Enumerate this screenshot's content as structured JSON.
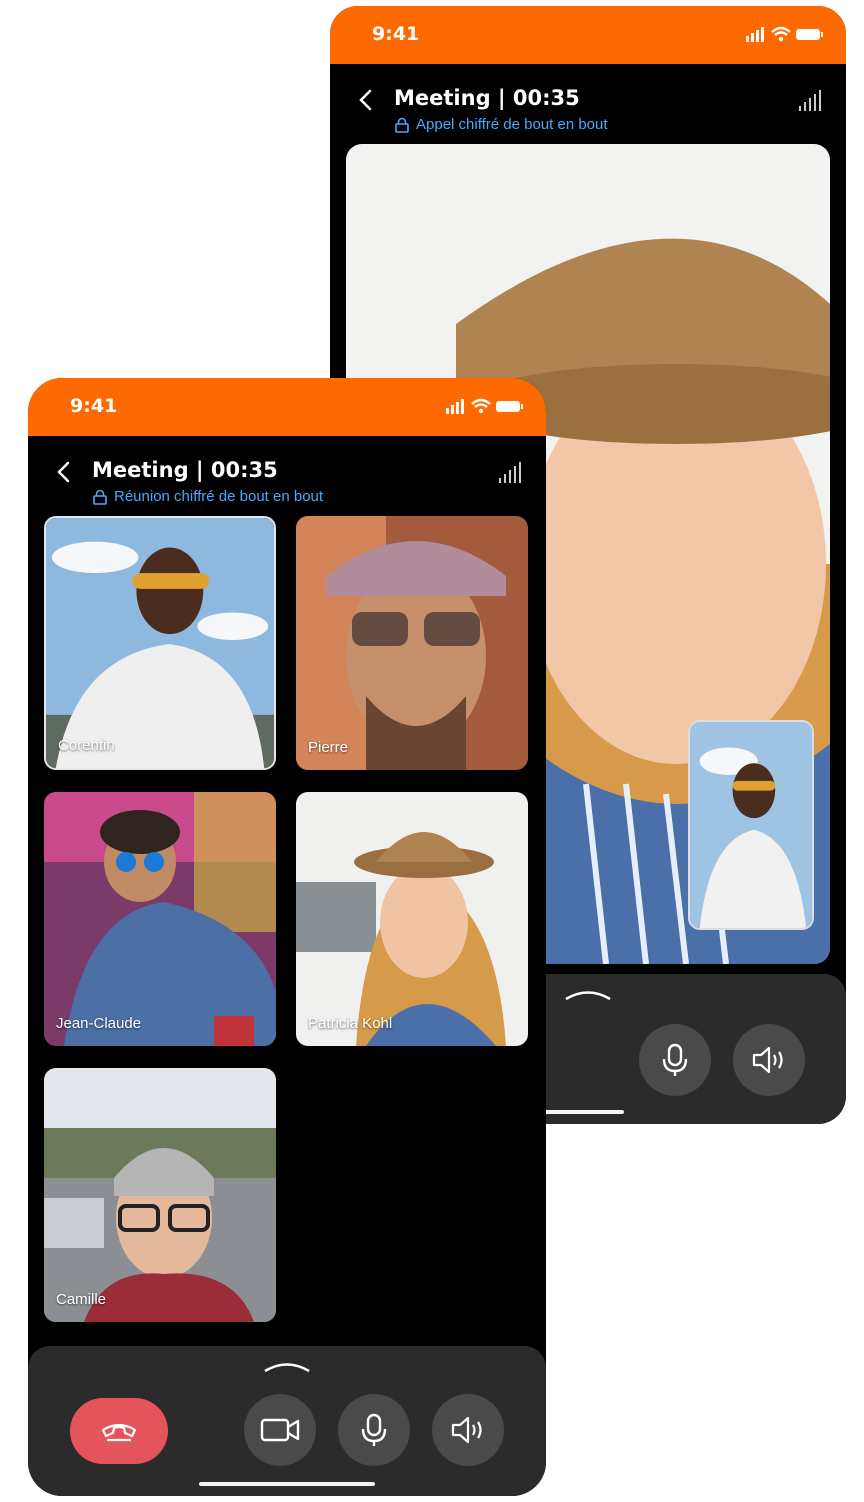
{
  "back_phone": {
    "status_time": "9:41",
    "title": "Meeting | 00:35",
    "encryption_text": "Appel chiffré de bout en bout"
  },
  "front_phone": {
    "status_time": "9:41",
    "title": "Meeting | 00:35",
    "encryption_text": "Réunion chiffré de bout en bout",
    "participants": [
      {
        "name": "Corentin"
      },
      {
        "name": "Pierre"
      },
      {
        "name": "Jean-Claude"
      },
      {
        "name": "Patricia Kohl"
      },
      {
        "name": "Camille"
      }
    ]
  },
  "controls": {
    "icons": [
      "chevron-up-icon",
      "hang-up-icon",
      "video-camera-icon",
      "microphone-icon",
      "speaker-icon"
    ]
  },
  "colors": {
    "brand_orange": "#ff6a00",
    "encryption_blue": "#4aa8ff",
    "hangup_red": "#e5545a",
    "panel_dark": "#2b2b2b"
  }
}
